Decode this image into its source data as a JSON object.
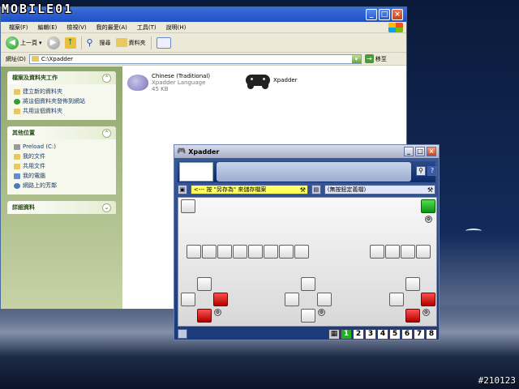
{
  "overlay": {
    "logo": "MOBILE01",
    "watermark": "#210123"
  },
  "explorer": {
    "menu": [
      "檔案(F)",
      "編輯(E)",
      "檢視(V)",
      "我的最愛(A)",
      "工具(T)",
      "說明(H)"
    ],
    "toolbar": {
      "back": "上一頁",
      "search": "搜尋",
      "folders": "資料夾"
    },
    "address": {
      "label": "網址(D)",
      "value": "C:\\Xpadder",
      "go": "移至"
    },
    "panels": [
      {
        "title": "檔案及資料夾工作",
        "items": [
          "建立新的資料夾",
          "將這個資料夾發佈到網站",
          "共用這個資料夾"
        ]
      },
      {
        "title": "其他位置",
        "items": [
          "Preload (C:)",
          "我的文件",
          "共用文件",
          "我的電腦",
          "網路上的芳鄰"
        ]
      },
      {
        "title": "詳細資料",
        "items": []
      }
    ],
    "files": [
      {
        "name": "Chinese (Traditional)",
        "type": "Xpadder Language",
        "size": "45 KB"
      },
      {
        "name": "Xpadder"
      }
    ]
  },
  "xpadder": {
    "title": "Xpadder",
    "profile_hint": "<--- 按 \"另存為\" 來儲存檔案",
    "set_hint": "(無按鈕定義檔)",
    "slots": [
      "1",
      "2",
      "3",
      "4",
      "5",
      "6",
      "7",
      "8"
    ],
    "active_slot": "1",
    "colors": {
      "red": "#d01010",
      "green": "#20c020",
      "active_slot": "#20b020"
    }
  }
}
